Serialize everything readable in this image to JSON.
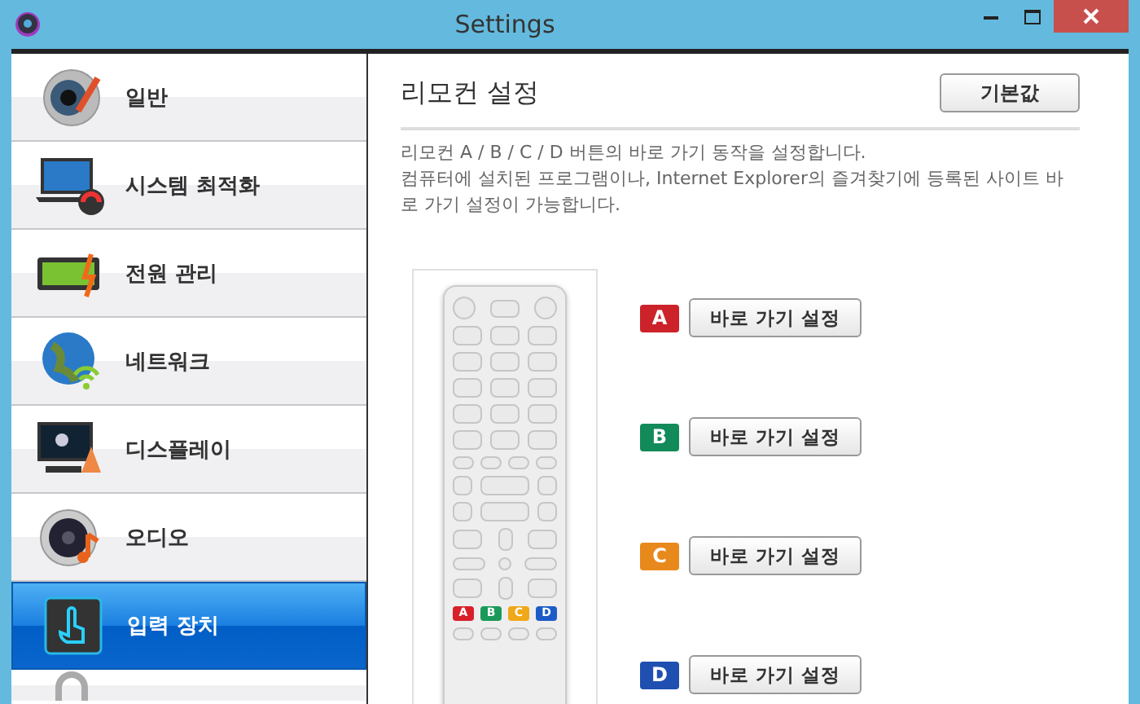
{
  "window": {
    "title": "Settings"
  },
  "sidebar": {
    "items": [
      {
        "kind": "general",
        "label": "일반",
        "selected": false
      },
      {
        "kind": "system",
        "label": "시스템 최적화",
        "selected": false
      },
      {
        "kind": "power",
        "label": "전원 관리",
        "selected": false
      },
      {
        "kind": "network",
        "label": "네트워크",
        "selected": false
      },
      {
        "kind": "display",
        "label": "디스플레이",
        "selected": false
      },
      {
        "kind": "audio",
        "label": "오디오",
        "selected": false
      },
      {
        "kind": "input",
        "label": "입력 장치",
        "selected": true
      },
      {
        "kind": "security",
        "selected": false
      }
    ]
  },
  "panel": {
    "title": "리모컨 설정",
    "reset_button": "기본값",
    "description": [
      "리모컨 A / B / C / D 버튼의 바로 가기 동작을 설정합니다.",
      "컴퓨터에 설치된 프로그램이나, Internet  Explorer의 즐겨찾기에 등록된 사이트 바로 가기 설정이 가능합니다."
    ],
    "remote_keys": [
      {
        "label": "A",
        "color": "#d8202a"
      },
      {
        "label": "B",
        "color": "#1a9a5a"
      },
      {
        "label": "C",
        "color": "#f0a818"
      },
      {
        "label": "D",
        "color": "#1d5cc8"
      }
    ],
    "shortcuts": [
      {
        "key": "A",
        "color": "#cc2229",
        "button": "바로 가기 설정"
      },
      {
        "key": "B",
        "color": "#138a5a",
        "button": "바로 가기 설정"
      },
      {
        "key": "C",
        "color": "#e8891c",
        "button": "바로 가기 설정"
      },
      {
        "key": "D",
        "color": "#1f4fb0",
        "button": "바로 가기 설정"
      }
    ]
  }
}
